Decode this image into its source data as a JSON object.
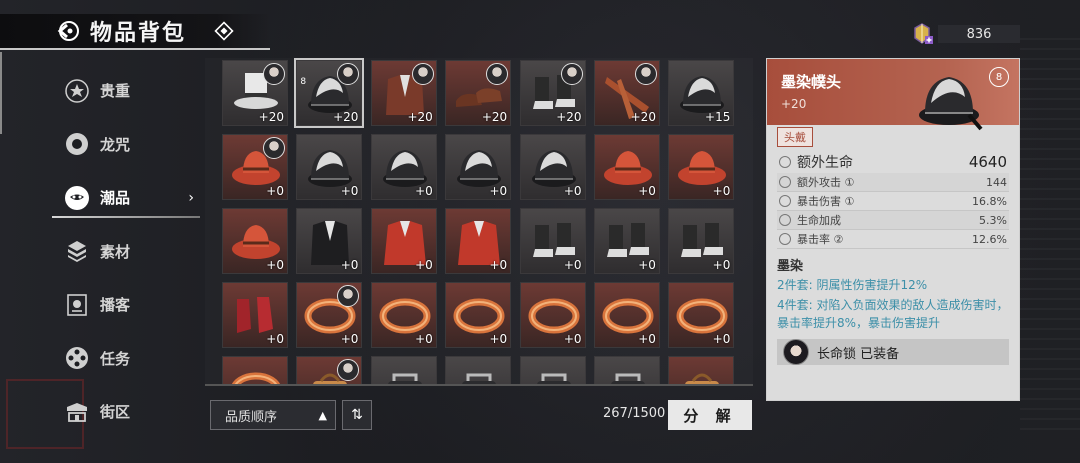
{
  "header": {
    "title": "物品背包"
  },
  "currency": {
    "amount": "836"
  },
  "sidebar": {
    "items": [
      {
        "label": "贵重",
        "icon": "star-badge-icon"
      },
      {
        "label": "龙咒",
        "icon": "ring-icon"
      },
      {
        "label": "潮品",
        "icon": "mask-icon",
        "active": true
      },
      {
        "label": "素材",
        "icon": "cube-stack-icon"
      },
      {
        "label": "播客",
        "icon": "podcast-icon"
      },
      {
        "label": "任务",
        "icon": "reel-icon"
      },
      {
        "label": "街区",
        "icon": "street-icon"
      }
    ]
  },
  "inventory": {
    "items": [
      {
        "kind": "top-hat",
        "count": "+20",
        "portrait": true
      },
      {
        "kind": "helmet",
        "count": "+20",
        "portrait": true,
        "locked": true,
        "selected": true
      },
      {
        "kind": "jacket",
        "count": "+20",
        "portrait": true
      },
      {
        "kind": "shoes-brown",
        "count": "+20",
        "portrait": true
      },
      {
        "kind": "boots",
        "count": "+20",
        "portrait": true
      },
      {
        "kind": "scarf",
        "count": "+20",
        "portrait": true
      },
      {
        "kind": "helmet",
        "count": "+15",
        "portrait": false
      },
      {
        "kind": "red-hat",
        "count": "+0",
        "portrait": true
      },
      {
        "kind": "helmet",
        "count": "+0"
      },
      {
        "kind": "helmet",
        "count": "+0"
      },
      {
        "kind": "helmet",
        "count": "+0"
      },
      {
        "kind": "helmet",
        "count": "+0"
      },
      {
        "kind": "red-hat",
        "count": "+0"
      },
      {
        "kind": "red-hat",
        "count": "+0"
      },
      {
        "kind": "red-hat",
        "count": "+0"
      },
      {
        "kind": "black-coat",
        "count": "+0"
      },
      {
        "kind": "red-coat",
        "count": "+0"
      },
      {
        "kind": "red-coat",
        "count": "+0"
      },
      {
        "kind": "boots",
        "count": "+0"
      },
      {
        "kind": "boots",
        "count": "+0"
      },
      {
        "kind": "boots",
        "count": "+0"
      },
      {
        "kind": "heels",
        "count": "+0"
      },
      {
        "kind": "ring",
        "count": "+0",
        "portrait": true
      },
      {
        "kind": "ring",
        "count": "+0"
      },
      {
        "kind": "ring",
        "count": "+0"
      },
      {
        "kind": "ring",
        "count": "+0"
      },
      {
        "kind": "ring",
        "count": "+0"
      },
      {
        "kind": "ring",
        "count": "+0"
      },
      {
        "kind": "ring",
        "count": ""
      },
      {
        "kind": "bag",
        "count": "",
        "portrait": true
      },
      {
        "kind": "purse",
        "count": ""
      },
      {
        "kind": "purse",
        "count": ""
      },
      {
        "kind": "purse",
        "count": ""
      },
      {
        "kind": "purse",
        "count": ""
      },
      {
        "kind": "bag",
        "count": ""
      }
    ]
  },
  "bottom": {
    "sort_label": "品质顺序",
    "capacity": "267/1500",
    "decompose_label": "分 解"
  },
  "detail": {
    "name": "墨染幞头",
    "level": "+20",
    "slot": "头戴",
    "main_stat": {
      "label": "额外生命",
      "value": "4640"
    },
    "sub_stats": [
      {
        "label": "额外攻击 ①",
        "value": "144"
      },
      {
        "label": "暴击伤害 ①",
        "value": "16.8%"
      },
      {
        "label": "生命加成",
        "value": "5.3%"
      },
      {
        "label": "暴击率 ②",
        "value": "12.6%"
      }
    ],
    "set_title": "墨染",
    "set_2": "2件套: 阴属性伤害提升12%",
    "set_4": "4件套: 对陷入负面效果的敌人造成伤害时，暴击率提升8%，暴击伤害提升",
    "equipped_text": "长命锁 已装备"
  },
  "colors": {
    "accent": "#a74e3c",
    "teal": "#3c8fa8"
  }
}
